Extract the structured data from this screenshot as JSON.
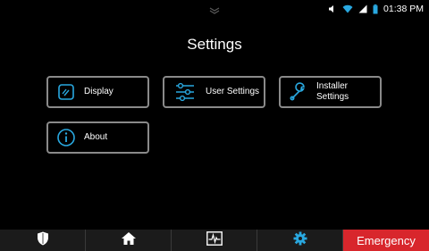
{
  "status_bar": {
    "time": "01:38 PM",
    "icons": [
      "volume-icon",
      "wifi-icon",
      "signal-icon",
      "battery-icon"
    ]
  },
  "page_title": "Settings",
  "tiles": {
    "display": {
      "label": "Display",
      "icon": "display-icon"
    },
    "user_settings": {
      "label": "User Settings",
      "icon": "sliders-icon"
    },
    "installer_settings": {
      "label_line1": "Installer",
      "label_line2": "Settings",
      "icon": "wrench-icon"
    },
    "about": {
      "label": "About",
      "icon": "info-icon"
    }
  },
  "nav": {
    "items": [
      "shield-icon",
      "home-icon",
      "activity-icon",
      "gear-icon"
    ],
    "emergency_label": "Emergency"
  },
  "colors": {
    "accent": "#29a8e0",
    "emergency": "#d8262c",
    "tile_border": "#8a8a8a"
  }
}
